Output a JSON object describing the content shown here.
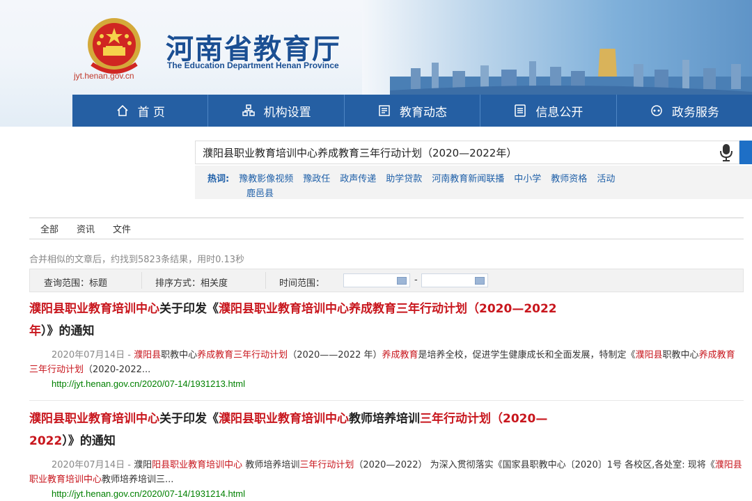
{
  "header": {
    "site_title": "河南省教育厅",
    "site_subtitle": "The Education Department Henan Province",
    "site_url": "jyt.henan.gov.cn",
    "brand_color": "#255fa3"
  },
  "nav": [
    {
      "label": "首 页",
      "icon": "home-icon"
    },
    {
      "label": "机构设置",
      "icon": "org-icon"
    },
    {
      "label": "教育动态",
      "icon": "news-icon"
    },
    {
      "label": "信息公开",
      "icon": "info-icon"
    },
    {
      "label": "政务服务",
      "icon": "service-icon"
    }
  ],
  "search": {
    "query": "濮阳县职业教育培训中心养成教育三年行动计划（2020—2022年）"
  },
  "hot": {
    "label": "热词:",
    "items": [
      "豫教影像视频",
      "豫政任",
      "政声传递",
      "助学贷款",
      "河南教育新闻联播",
      "中小学",
      "教师资格",
      "活动"
    ],
    "second_row": "鹿邑县"
  },
  "tabs": [
    "全部",
    "资讯",
    "文件"
  ],
  "summary": "合并相似的文章后，约找到5823条结果，用时0.13秒",
  "filter": {
    "scope": "查询范围：标题",
    "sort": "排序方式：相关度",
    "time": "时间范围：",
    "dash": "-"
  },
  "results": [
    {
      "title_hl1": "濮阳县职业教育培训中心",
      "title_mid": "关于印发《",
      "title_hl2": "濮阳县职业教育培训中心养成教育三年行动计划",
      "title_tail1": "（2020—2022",
      "title_line2": "年）》的通知",
      "date": "2020年07月14日 -",
      "snip_hl1": "濮阳县",
      "snip_t1": "职教中心",
      "snip_hl2": "养成教育三年行动计划",
      "snip_t2": "（2020——2022 年）",
      "snip_hl3": "养成教育",
      "snip_t3": "是培养全校，促进学生健康成长和全面发展，特制定《",
      "snip_hl4": "濮阳县",
      "snip_t4": "职教中心",
      "snip_hl5": "养成教育三年行动计划",
      "snip_t5": "（2020-2022...",
      "url": "http://jyt.henan.gov.cn/2020/07-14/1931213.html"
    },
    {
      "title_hl1": "濮阳县职业教育培训中心",
      "title_mid": "关于印发《",
      "title_hl2": "濮阳县职业教育培训中心",
      "title_t2": "教师培养培训",
      "title_hl3": "三年行动计划",
      "title_tail1": "（2020—",
      "title_line2": "2022）》的通知",
      "date": "2020年07月14日 -",
      "snip_t0": "濮阳",
      "snip_hl1": "阳县职业教育培训中心",
      "snip_t1": "教师培养培训",
      "snip_hl2": "三年行动计划",
      "snip_t2": "（2020—2022）  为深入贯彻落实《国家县职教中心〔2020〕1号 各校区,各处室: 现将《",
      "snip_hl3": "濮阳县职业教育培训中心",
      "snip_t3": "教师培养培训三...",
      "url": "http://jyt.henan.gov.cn/2020/07-14/1931214.html"
    }
  ]
}
